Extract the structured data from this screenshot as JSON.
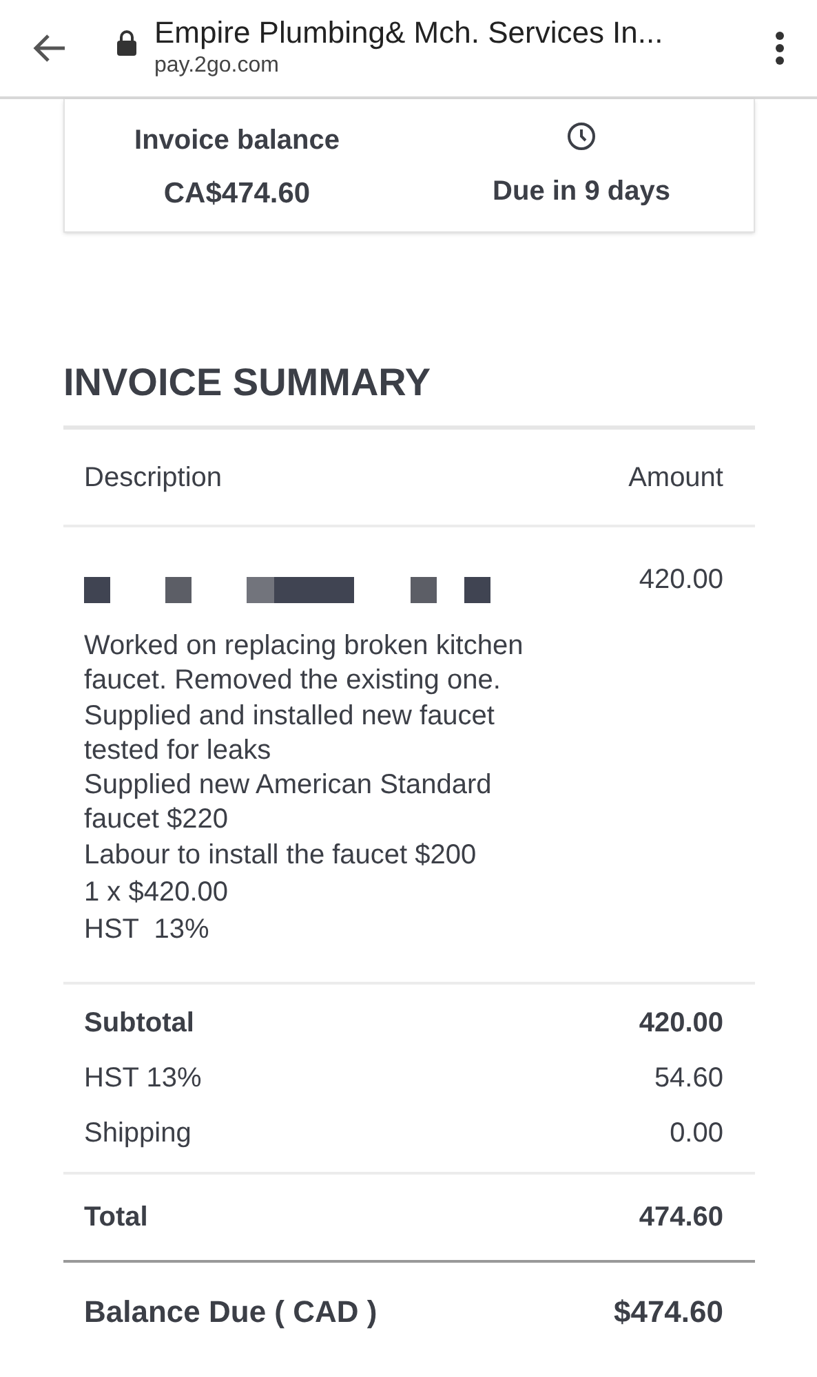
{
  "browser_bar": {
    "title": "Empire Plumbing& Mch. Services In...",
    "url": "pay.2go.com"
  },
  "balance_card": {
    "label": "Invoice balance",
    "amount": "CA$474.60",
    "due": "Due in 9 days"
  },
  "heading": "INVOICE SUMMARY",
  "table": {
    "columns": [
      "Description",
      "Amount"
    ],
    "items": [
      {
        "amount": "420.00",
        "lines": [
          "Worked on replacing broken kitchen",
          "faucet. Removed the existing one.",
          "Supplied and installed new faucet",
          "tested for leaks",
          "Supplied new American Standard",
          "faucet $220",
          "Labour to install the faucet $200",
          "1 x $420.00",
          "HST  13%"
        ]
      }
    ]
  },
  "totals": [
    {
      "label": "Subtotal",
      "value": "420.00",
      "bold": true
    },
    {
      "label": "HST 13%",
      "value": "54.60",
      "bold": false
    },
    {
      "label": "Shipping",
      "value": "0.00",
      "bold": false
    }
  ],
  "total": {
    "label": "Total",
    "value": "474.60"
  },
  "balance_due": {
    "label": "Balance Due ( CAD )",
    "value": "$474.60"
  }
}
